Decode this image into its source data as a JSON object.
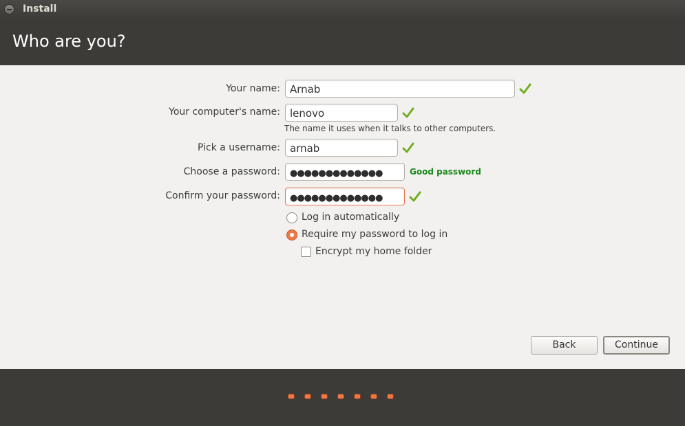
{
  "window": {
    "title": "Install"
  },
  "header": {
    "title": "Who are you?"
  },
  "form": {
    "name": {
      "label": "Your name:",
      "value": "Arnab"
    },
    "computer": {
      "label": "Your computer's name:",
      "value": "lenovo",
      "hint": "The name it uses when it talks to other computers."
    },
    "username": {
      "label": "Pick a username:",
      "value": "arnab"
    },
    "password": {
      "label": "Choose a password:",
      "masked": "●●●●●●●●●●●●●",
      "strength": "Good password"
    },
    "confirm": {
      "label": "Confirm your password:",
      "masked": "●●●●●●●●●●●●●"
    }
  },
  "options": {
    "login_auto": {
      "label": "Log in automatically",
      "selected": false
    },
    "require_password": {
      "label": "Require my password to log in",
      "selected": true
    },
    "encrypt_home": {
      "label": "Encrypt my home folder",
      "checked": false
    }
  },
  "buttons": {
    "back": "Back",
    "continue": "Continue"
  },
  "progress": {
    "steps": 7
  },
  "colors": {
    "accent": "#f07746",
    "header_bg": "#3c3b37",
    "content_bg": "#f2f1f0",
    "check_green": "#6fae1f",
    "strength_green": "#1a8a1a"
  }
}
